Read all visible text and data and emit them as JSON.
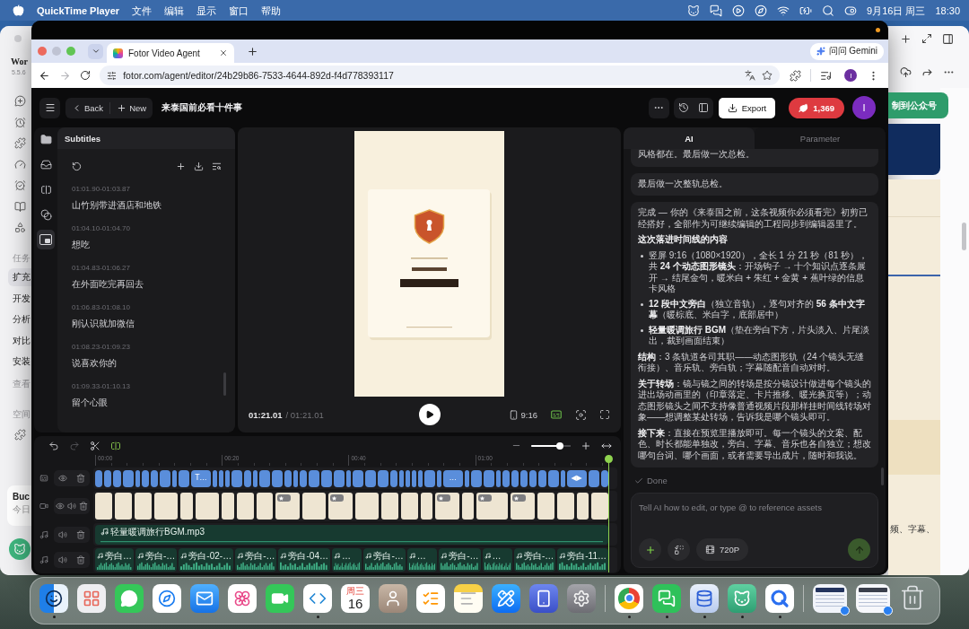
{
  "menu_bar": {
    "app_name": "QuickTime Player",
    "menus": [
      "文件",
      "编辑",
      "显示",
      "窗口",
      "帮助"
    ],
    "date": "9月16日 周三",
    "time": "18:30"
  },
  "background_window": {
    "app_title": "Wor",
    "version": "5.5.6",
    "task_heading": "任务",
    "tasks": [
      {
        "label": "扩充",
        "selected": true
      },
      {
        "label": "开发",
        "selected": false
      },
      {
        "label": "分析",
        "selected": false
      },
      {
        "label": "对比",
        "selected": false
      },
      {
        "label": "安装",
        "selected": false
      }
    ],
    "view_more": "查看",
    "space_heading": "空间",
    "card": {
      "title": "Buc",
      "subtitle": "今日"
    },
    "publish_button": "制到公众号",
    "body_text": "频、字幕、"
  },
  "browser": {
    "tabs": [
      {
        "title": "Fotor Video Agent",
        "selected": true
      }
    ],
    "gemini_button": "问问 Gemini",
    "forward_disabled": true,
    "url": "fotor.com/agent/editor/24b29b86-7533-4644-892d-f4d778393117",
    "profile_initial": "I"
  },
  "header": {
    "back": "Back",
    "new": "New",
    "project_title": "来泰国前必看十件事",
    "export": "Export",
    "credits": "1,369",
    "avatar_initial": "I"
  },
  "tool_rail": [
    {
      "selected": false
    },
    {
      "selected": false
    },
    {
      "selected": false
    },
    {
      "selected": false
    },
    {
      "selected": true
    }
  ],
  "subtitles": {
    "title": "Subtitles",
    "entries": [
      {
        "time": "01:01.90-01:03.87",
        "text": "山竹别带进酒店和地铁"
      },
      {
        "time": "01:04.10-01:04.70",
        "text": "想吃"
      },
      {
        "time": "01:04.83-01:06.27",
        "text": "在外面吃完再回去"
      },
      {
        "time": "01:06.83-01:08.10",
        "text": "刚认识就加微信"
      },
      {
        "time": "01:08.23-01:09.23",
        "text": "说喜欢你的"
      },
      {
        "time": "01:09.33-01:10.13",
        "text": "留个心眼"
      }
    ]
  },
  "preview": {
    "current_time": "01:21.01",
    "total_time": "/ 01:21.01",
    "aspect_ratio": "9:16",
    "captions_on": true
  },
  "timeline": {
    "redo_disabled": true,
    "snapping_on": true,
    "zoom": {
      "level": 0.72
    },
    "ruler": [
      "00:00",
      "00:20",
      "00:40",
      "01:00"
    ],
    "playhead": {
      "level": 1
    },
    "tracks": [
      {
        "kind": "subtitle",
        "visible": true,
        "clips": [
          {
            "kind": "medium"
          },
          {
            "kind": "medium"
          },
          {
            "kind": "medium"
          },
          {
            "kind": "long"
          },
          {
            "kind": "short"
          },
          {
            "kind": "medium"
          },
          {
            "kind": "medium"
          },
          {
            "kind": "long"
          },
          {
            "kind": "short"
          },
          {
            "kind": "long"
          },
          {
            "kind": "wide",
            "label": "T…"
          },
          {
            "kind": "short"
          },
          {
            "kind": "short"
          },
          {
            "kind": "short"
          },
          {
            "kind": "long"
          },
          {
            "kind": "medium"
          },
          {
            "kind": "short"
          },
          {
            "kind": "long"
          },
          {
            "kind": "long"
          },
          {
            "kind": "medium"
          },
          {
            "kind": "short"
          },
          {
            "kind": "medium"
          },
          {
            "kind": "long"
          },
          {
            "kind": "long"
          },
          {
            "kind": "long"
          },
          {
            "kind": "short"
          },
          {
            "kind": "long"
          },
          {
            "kind": "long"
          },
          {
            "kind": "long"
          },
          {
            "kind": "medium"
          },
          {
            "kind": "short"
          },
          {
            "kind": "short"
          },
          {
            "kind": "short"
          },
          {
            "kind": "short"
          },
          {
            "kind": "long"
          },
          {
            "kind": "short"
          },
          {
            "kind": "wide",
            "label": "…"
          },
          {
            "kind": "short"
          },
          {
            "kind": "long"
          },
          {
            "kind": "long"
          },
          {
            "kind": "short"
          },
          {
            "kind": "medium"
          },
          {
            "kind": "medium"
          },
          {
            "kind": "medium"
          },
          {
            "kind": "medium"
          },
          {
            "kind": "medium"
          },
          {
            "kind": "long"
          },
          {
            "kind": "short"
          },
          {
            "kind": "wide",
            "label": "◀▶"
          },
          {
            "kind": "long"
          },
          {
            "kind": "medium"
          }
        ]
      },
      {
        "kind": "video",
        "visible": true,
        "muted": false,
        "clips": [
          {
            "kind": "medium",
            "badge": false
          },
          {
            "kind": "medium",
            "badge": false
          },
          {
            "kind": "medium",
            "badge": false
          },
          {
            "kind": "long",
            "badge": false
          },
          {
            "kind": "short",
            "badge": false
          },
          {
            "kind": "long",
            "badge": false
          },
          {
            "kind": "short",
            "badge": false
          },
          {
            "kind": "medium",
            "badge": false
          },
          {
            "kind": "medium",
            "badge": false
          },
          {
            "kind": "long",
            "badge": true
          },
          {
            "kind": "long",
            "badge": false
          },
          {
            "kind": "long",
            "badge": true
          },
          {
            "kind": "long",
            "badge": false
          },
          {
            "kind": "medium",
            "badge": false
          },
          {
            "kind": "medium",
            "badge": false
          },
          {
            "kind": "short",
            "badge": false
          },
          {
            "kind": "long",
            "badge": true
          },
          {
            "kind": "short",
            "badge": false
          },
          {
            "kind": "wide",
            "badge": true
          },
          {
            "kind": "long",
            "badge": true
          },
          {
            "kind": "medium",
            "badge": false
          },
          {
            "kind": "medium",
            "badge": false
          },
          {
            "kind": "short",
            "badge": false
          },
          {
            "kind": "medium",
            "badge": false
          }
        ]
      },
      {
        "kind": "music",
        "muted": false,
        "clips": [
          {
            "label": "轻量暖调旅行BGM.mp3"
          }
        ]
      },
      {
        "kind": "narration",
        "muted": false,
        "clips": [
          {
            "kind": "medium",
            "label": "旁白…"
          },
          {
            "kind": "medium",
            "label": "旁白-…"
          },
          {
            "kind": "long",
            "label": "旁白-02-…"
          },
          {
            "kind": "medium",
            "label": "旁白-…"
          },
          {
            "kind": "long",
            "label": "旁白-04…"
          },
          {
            "kind": "short",
            "label": "…"
          },
          {
            "kind": "medium",
            "label": "旁白-…"
          },
          {
            "kind": "short",
            "label": "…"
          },
          {
            "kind": "medium",
            "label": "旁白-…"
          },
          {
            "kind": "short",
            "label": "…"
          },
          {
            "kind": "medium",
            "label": "旁白-…"
          },
          {
            "kind": "long",
            "label": "旁白-11…"
          }
        ]
      }
    ]
  },
  "assistant": {
    "tabs": [
      {
        "label": "AI",
        "selected": true
      },
      {
        "label": "Parameter",
        "selected": false
      }
    ],
    "messages": [
      {
        "blocks": [
          {
            "kind": "paragraph",
            "text": "风格都在。最后做一次总检。"
          }
        ]
      },
      {
        "blocks": [
          {
            "kind": "paragraph",
            "text": "最后做一次整轨总检。"
          }
        ]
      },
      {
        "blocks": [
          {
            "kind": "paragraph",
            "text": "完成 — 你的《来泰国之前，这条视频你必须看完》初剪已经搭好，全部作为可继续编辑的工程同步到编辑器里了。"
          },
          {
            "kind": "heading",
            "text": "这次落进时间线的内容"
          },
          {
            "kind": "bullets",
            "items": [
              "竖屏 9:16（1080×1920），全长 1 分 21 秒（81 秒），共 **24 个动态图形镜头**：开场钩子 → 十个知识点逐条展开 → 结尾金句，暖米白 + 朱红 + 金黄 + 蕉叶绿的信息卡风格",
              "**12 段中文旁白**（独立音轨），逐句对齐的 **56 条中文字幕**（暖棕底、米白字，底部居中）",
              "**轻量暖调旅行 BGM**（垫在旁白下方，片头淡入、片尾淡出，裁到画面结束）"
            ]
          },
          {
            "kind": "paragraph",
            "text": "**结构**：3 条轨道各司其职——动态图形轨（24 个镜头无缝衔接）、音乐轨、旁白轨；字幕随配音自动对时。"
          },
          {
            "kind": "paragraph",
            "text": "**关于转场**：镜与镜之间的转场是按分镜设计做进每个镜头的进出场动画里的（印章落定、卡片推移、暖光换页等）；动态图形镜头之间不支持像普通视频片段那样挂时间线转场对象——想调整某处转场，告诉我是哪个镜头即可。"
          },
          {
            "kind": "paragraph",
            "text": "**接下来**：直接在预览里播放即可。每一个镜头的文案、配色、时长都能单独改，旁白、字幕、音乐也各自独立；想改哪句台词、哪个画面，或者需要导出成片，随时和我说。"
          }
        ]
      }
    ],
    "status": {
      "label": "Done",
      "done": true
    },
    "composer": {
      "placeholder": "Tell AI how to edit, or type @ to reference assets",
      "quality": "720P",
      "send": {
        "disabled": true
      }
    }
  },
  "dock": {
    "apps": [
      {
        "running": true
      },
      {
        "running": false
      },
      {
        "running": false
      },
      {
        "running": false
      },
      {
        "running": false
      },
      {
        "running": false
      },
      {
        "running": false
      },
      {
        "running": true
      },
      {
        "running": false,
        "weekday": "周三",
        "day": "16"
      },
      {
        "running": false
      },
      {
        "running": false
      },
      {
        "running": false
      },
      {
        "running": false
      },
      {
        "running": false
      },
      {
        "running": false
      }
    ],
    "recent_apps": [
      {
        "running": true
      },
      {
        "running": true
      },
      {
        "running": true
      },
      {
        "running": true
      },
      {
        "running": true
      }
    ]
  }
}
